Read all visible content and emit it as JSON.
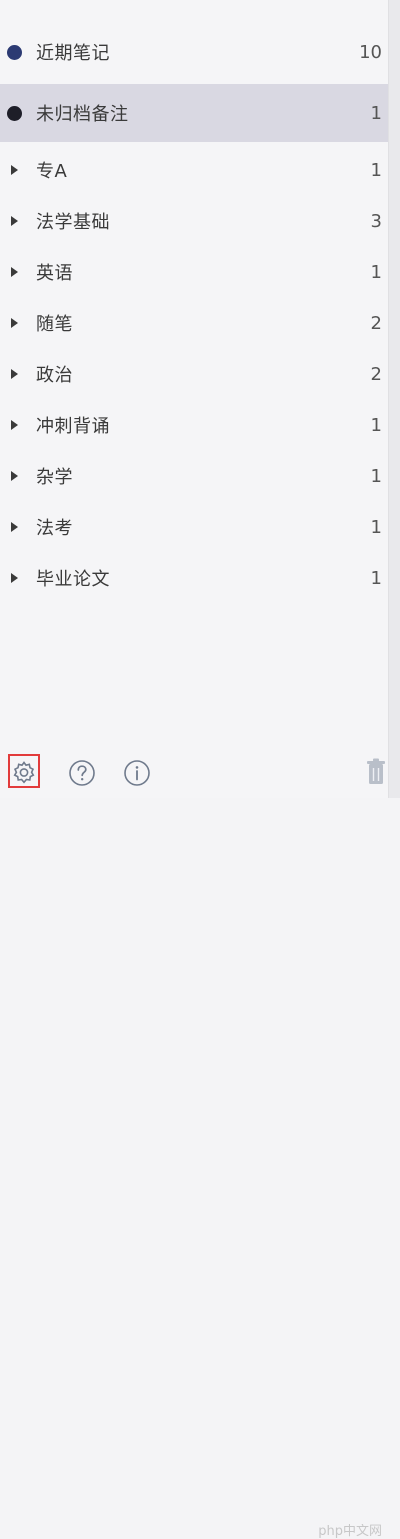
{
  "top_partial_text": "",
  "sections": [
    {
      "label": "近期笔记",
      "count": "10",
      "marker": "dot",
      "dot_color": "#2c3a73",
      "selected": false
    },
    {
      "label": "未归档备注",
      "count": "1",
      "marker": "dot",
      "dot_color": "#1e1e28",
      "selected": true
    }
  ],
  "folders": [
    {
      "label": "专A",
      "count": "1"
    },
    {
      "label": "法学基础",
      "count": "3"
    },
    {
      "label": "英语",
      "count": "1"
    },
    {
      "label": "随笔",
      "count": "2"
    },
    {
      "label": "政治",
      "count": "2"
    },
    {
      "label": "冲刺背诵",
      "count": "1"
    },
    {
      "label": "杂学",
      "count": "1"
    },
    {
      "label": "法考",
      "count": "1"
    },
    {
      "label": "毕业论文",
      "count": "1"
    }
  ],
  "toolbar": {
    "settings_icon": "gear-icon",
    "help_icon": "question-icon",
    "info_icon": "info-icon",
    "trash_icon": "trash-icon",
    "watermark": "php中文网"
  },
  "colors": {
    "selected_row": "#d9d8e2",
    "icon_stroke": "#6f7a8c",
    "highlight_frame": "#e23b3b"
  }
}
